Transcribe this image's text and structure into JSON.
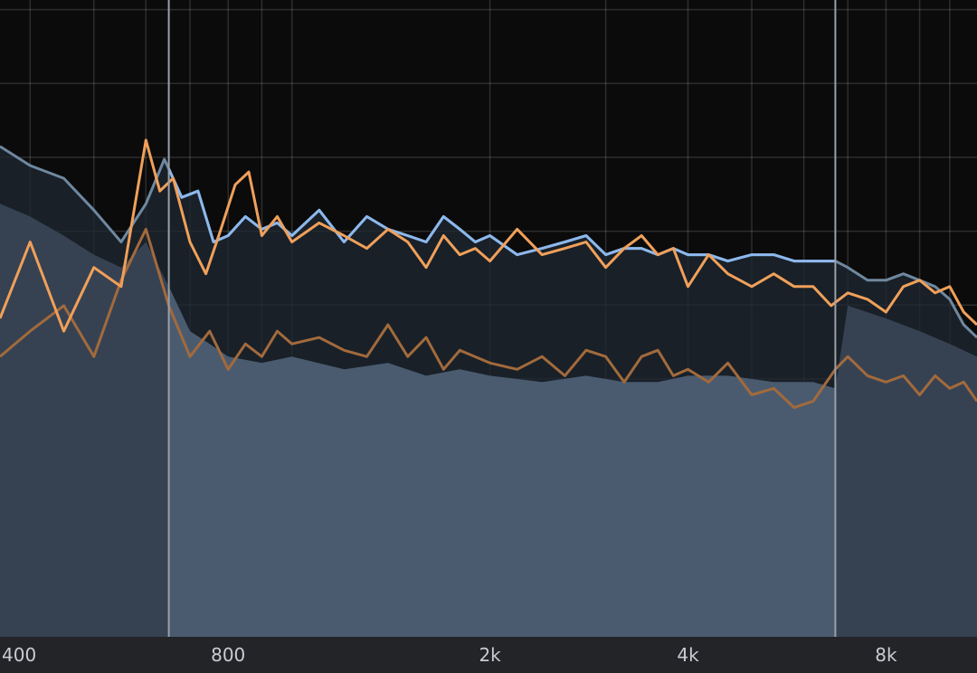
{
  "colors": {
    "background": "#0b0b0c",
    "grid": "#ffffff",
    "active_band_fill": "#4a5b70",
    "outer_fill": "#1d2631",
    "blue_line": "#8cb8ec",
    "blue_line_outer": "#6f889f",
    "orange_line": "#f0a05a",
    "orange_line_dim": "#a26a3c",
    "axis_bar": "#232427",
    "axis_text": "#c9ccd2",
    "band_border": "#9aa0a8"
  },
  "chart_data": {
    "type": "area",
    "x_scale": "log",
    "x_unit": "Hz",
    "xlim": [
      360,
      11000
    ],
    "ylim": [
      0,
      100
    ],
    "x_tick_labels": [
      {
        "value": 400,
        "label": "400"
      },
      {
        "value": 800,
        "label": "800"
      },
      {
        "value": 2000,
        "label": "2k"
      },
      {
        "value": 4000,
        "label": "4k"
      },
      {
        "value": 8000,
        "label": "8k"
      }
    ],
    "vertical_grid": [
      400,
      500,
      600,
      700,
      800,
      900,
      1000,
      2000,
      3000,
      4000,
      5000,
      6000,
      7000,
      8000,
      9000,
      10000
    ],
    "horizontal_grid": [
      5.8,
      17.4,
      29.0,
      40.5,
      52.1,
      63.7,
      75.3,
      86.9,
      98.5
    ],
    "active_band": [
      650,
      6700
    ],
    "series": [
      {
        "role": "blue-line",
        "x": [
          360,
          400,
          450,
          500,
          550,
          600,
          640,
          680,
          720,
          760,
          800,
          850,
          900,
          950,
          1000,
          1100,
          1200,
          1300,
          1400,
          1500,
          1600,
          1700,
          1800,
          1900,
          2000,
          2200,
          2400,
          2600,
          2800,
          3000,
          3200,
          3400,
          3600,
          3800,
          4000,
          4300,
          4600,
          5000,
          5400,
          5800,
          6200,
          6700,
          7000,
          7500,
          8000,
          8500,
          9000,
          9500,
          10000,
          10500,
          11000
        ],
        "y": [
          77,
          74,
          72,
          67,
          62,
          68,
          75,
          69,
          70,
          62,
          63,
          66,
          64,
          65,
          63,
          67,
          62,
          66,
          64,
          63,
          62,
          66,
          64,
          62,
          63,
          60,
          61,
          62,
          63,
          60,
          61,
          61,
          60,
          61,
          60,
          60,
          59,
          60,
          60,
          59,
          59,
          59,
          58,
          56,
          56,
          57,
          56,
          55,
          53,
          49,
          47
        ]
      },
      {
        "role": "orange-line",
        "x": [
          360,
          400,
          450,
          500,
          550,
          600,
          630,
          660,
          700,
          740,
          780,
          820,
          860,
          900,
          950,
          1000,
          1100,
          1200,
          1300,
          1400,
          1500,
          1600,
          1700,
          1800,
          1900,
          2000,
          2200,
          2400,
          2600,
          2800,
          3000,
          3200,
          3400,
          3600,
          3800,
          4000,
          4300,
          4600,
          5000,
          5400,
          5800,
          6200,
          6600,
          7000,
          7500,
          8000,
          8500,
          9000,
          9500,
          10000,
          10500,
          11000
        ],
        "y": [
          50,
          62,
          48,
          58,
          55,
          78,
          70,
          72,
          62,
          57,
          64,
          71,
          73,
          63,
          66,
          62,
          65,
          63,
          61,
          64,
          62,
          58,
          63,
          60,
          61,
          59,
          64,
          60,
          61,
          62,
          58,
          61,
          63,
          60,
          61,
          55,
          60,
          57,
          55,
          57,
          55,
          55,
          52,
          54,
          53,
          51,
          55,
          56,
          54,
          55,
          51,
          49
        ]
      },
      {
        "role": "orange-dim-line",
        "x": [
          360,
          400,
          450,
          500,
          550,
          600,
          650,
          700,
          750,
          800,
          850,
          900,
          950,
          1000,
          1100,
          1200,
          1300,
          1400,
          1500,
          1600,
          1700,
          1800,
          2000,
          2200,
          2400,
          2600,
          2800,
          3000,
          3200,
          3400,
          3600,
          3800,
          4000,
          4300,
          4600,
          5000,
          5400,
          5800,
          6200,
          6700,
          7000,
          7500,
          8000,
          8500,
          9000,
          9500,
          10000,
          10500,
          11000
        ],
        "y": [
          44,
          48,
          52,
          44,
          56,
          64,
          52,
          44,
          48,
          42,
          46,
          44,
          48,
          46,
          47,
          45,
          44,
          49,
          44,
          47,
          42,
          45,
          43,
          42,
          44,
          41,
          45,
          44,
          40,
          44,
          45,
          41,
          42,
          40,
          43,
          38,
          39,
          36,
          37,
          42,
          44,
          41,
          40,
          41,
          38,
          41,
          39,
          40,
          37
        ]
      },
      {
        "role": "blue-area",
        "x": [
          360,
          400,
          450,
          500,
          550,
          600,
          650,
          700,
          750,
          800,
          900,
          1000,
          1200,
          1400,
          1600,
          1800,
          2000,
          2400,
          2800,
          3200,
          3600,
          4000,
          4600,
          5400,
          6200,
          6700,
          7000,
          8000,
          9000,
          10000,
          11000
        ],
        "y": [
          68,
          66,
          63,
          60,
          58,
          62,
          55,
          48,
          46,
          44,
          43,
          44,
          42,
          43,
          41,
          42,
          41,
          40,
          41,
          40,
          40,
          41,
          41,
          40,
          40,
          39,
          52,
          50,
          48,
          46,
          44
        ]
      }
    ]
  }
}
